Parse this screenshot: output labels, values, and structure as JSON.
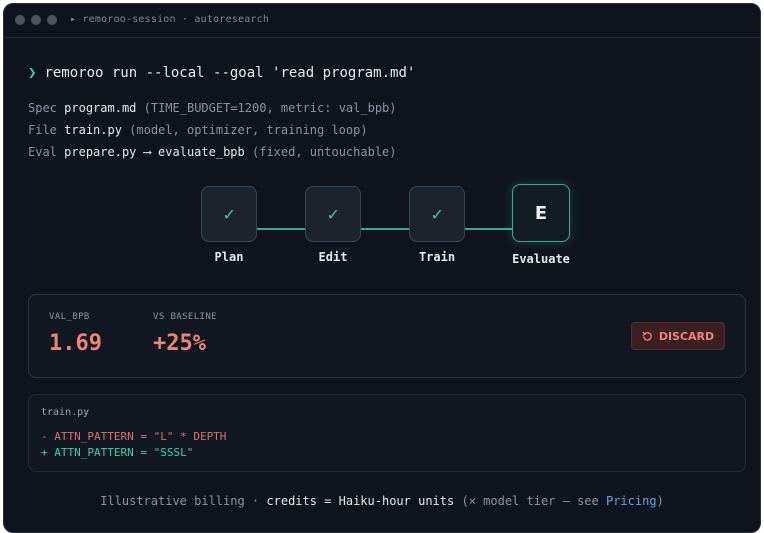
{
  "window": {
    "title": "▸ remoroo-session · autoresearch"
  },
  "command": {
    "prompt": "❯",
    "text": "remoroo run --local --goal 'read program.md'"
  },
  "info": [
    {
      "key": "Spec",
      "value": "program.md",
      "meta": "(TIME_BUDGET=1200, metric: val_bpb)"
    },
    {
      "key": "File",
      "value": "train.py",
      "meta": "(model, optimizer, training loop)"
    },
    {
      "key": "Eval",
      "value": "prepare.py ⟶ evaluate_bpb",
      "meta": "(fixed, untouchable)"
    }
  ],
  "steps": [
    {
      "label": "Plan",
      "status": "done",
      "icon": "check-icon",
      "glyph": "✓"
    },
    {
      "label": "Edit",
      "status": "done",
      "icon": "check-icon",
      "glyph": "✓"
    },
    {
      "label": "Train",
      "status": "done",
      "icon": "check-icon",
      "glyph": "✓"
    },
    {
      "label": "Evaluate",
      "status": "active",
      "glyph": "E"
    }
  ],
  "metrics": {
    "val_label": "VAL_BPB",
    "val_value": "1.69",
    "baseline_label": "VS BASELINE",
    "baseline_value": "+25%",
    "discard_label": "DISCARD",
    "discard_icon": "rotate-ccw-icon",
    "color_negative": "#f0827a"
  },
  "diff": {
    "filename": "train.py",
    "removed": "- ATTN_PATTERN = \"L\" * DEPTH",
    "added": "+ ATTN_PATTERN = \"SSSL\""
  },
  "footer": {
    "lead": "Illustrative billing ·",
    "highlight": "credits = Haiku-hour units",
    "note_open": "(× model tier — see",
    "link": "Pricing",
    "note_close": ")"
  },
  "colors": {
    "accent": "#3fd0a8",
    "background": "#0f141c",
    "link": "#5ea6f0"
  }
}
